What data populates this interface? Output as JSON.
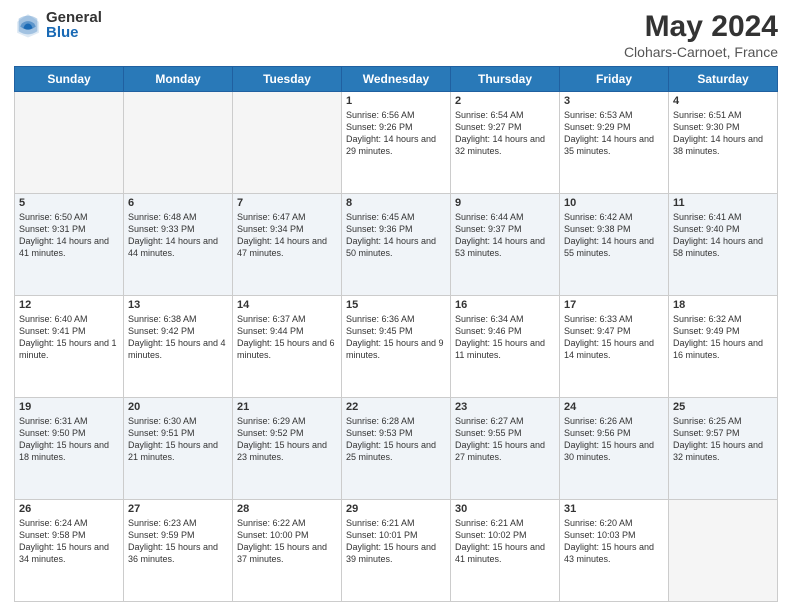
{
  "logo": {
    "general": "General",
    "blue": "Blue"
  },
  "header": {
    "title": "May 2024",
    "location": "Clohars-Carnoet, France"
  },
  "weekdays": [
    "Sunday",
    "Monday",
    "Tuesday",
    "Wednesday",
    "Thursday",
    "Friday",
    "Saturday"
  ],
  "weeks": [
    [
      {
        "day": "",
        "sunrise": "",
        "sunset": "",
        "daylight": ""
      },
      {
        "day": "",
        "sunrise": "",
        "sunset": "",
        "daylight": ""
      },
      {
        "day": "",
        "sunrise": "",
        "sunset": "",
        "daylight": ""
      },
      {
        "day": "1",
        "sunrise": "Sunrise: 6:56 AM",
        "sunset": "Sunset: 9:26 PM",
        "daylight": "Daylight: 14 hours and 29 minutes."
      },
      {
        "day": "2",
        "sunrise": "Sunrise: 6:54 AM",
        "sunset": "Sunset: 9:27 PM",
        "daylight": "Daylight: 14 hours and 32 minutes."
      },
      {
        "day": "3",
        "sunrise": "Sunrise: 6:53 AM",
        "sunset": "Sunset: 9:29 PM",
        "daylight": "Daylight: 14 hours and 35 minutes."
      },
      {
        "day": "4",
        "sunrise": "Sunrise: 6:51 AM",
        "sunset": "Sunset: 9:30 PM",
        "daylight": "Daylight: 14 hours and 38 minutes."
      }
    ],
    [
      {
        "day": "5",
        "sunrise": "Sunrise: 6:50 AM",
        "sunset": "Sunset: 9:31 PM",
        "daylight": "Daylight: 14 hours and 41 minutes."
      },
      {
        "day": "6",
        "sunrise": "Sunrise: 6:48 AM",
        "sunset": "Sunset: 9:33 PM",
        "daylight": "Daylight: 14 hours and 44 minutes."
      },
      {
        "day": "7",
        "sunrise": "Sunrise: 6:47 AM",
        "sunset": "Sunset: 9:34 PM",
        "daylight": "Daylight: 14 hours and 47 minutes."
      },
      {
        "day": "8",
        "sunrise": "Sunrise: 6:45 AM",
        "sunset": "Sunset: 9:36 PM",
        "daylight": "Daylight: 14 hours and 50 minutes."
      },
      {
        "day": "9",
        "sunrise": "Sunrise: 6:44 AM",
        "sunset": "Sunset: 9:37 PM",
        "daylight": "Daylight: 14 hours and 53 minutes."
      },
      {
        "day": "10",
        "sunrise": "Sunrise: 6:42 AM",
        "sunset": "Sunset: 9:38 PM",
        "daylight": "Daylight: 14 hours and 55 minutes."
      },
      {
        "day": "11",
        "sunrise": "Sunrise: 6:41 AM",
        "sunset": "Sunset: 9:40 PM",
        "daylight": "Daylight: 14 hours and 58 minutes."
      }
    ],
    [
      {
        "day": "12",
        "sunrise": "Sunrise: 6:40 AM",
        "sunset": "Sunset: 9:41 PM",
        "daylight": "Daylight: 15 hours and 1 minute."
      },
      {
        "day": "13",
        "sunrise": "Sunrise: 6:38 AM",
        "sunset": "Sunset: 9:42 PM",
        "daylight": "Daylight: 15 hours and 4 minutes."
      },
      {
        "day": "14",
        "sunrise": "Sunrise: 6:37 AM",
        "sunset": "Sunset: 9:44 PM",
        "daylight": "Daylight: 15 hours and 6 minutes."
      },
      {
        "day": "15",
        "sunrise": "Sunrise: 6:36 AM",
        "sunset": "Sunset: 9:45 PM",
        "daylight": "Daylight: 15 hours and 9 minutes."
      },
      {
        "day": "16",
        "sunrise": "Sunrise: 6:34 AM",
        "sunset": "Sunset: 9:46 PM",
        "daylight": "Daylight: 15 hours and 11 minutes."
      },
      {
        "day": "17",
        "sunrise": "Sunrise: 6:33 AM",
        "sunset": "Sunset: 9:47 PM",
        "daylight": "Daylight: 15 hours and 14 minutes."
      },
      {
        "day": "18",
        "sunrise": "Sunrise: 6:32 AM",
        "sunset": "Sunset: 9:49 PM",
        "daylight": "Daylight: 15 hours and 16 minutes."
      }
    ],
    [
      {
        "day": "19",
        "sunrise": "Sunrise: 6:31 AM",
        "sunset": "Sunset: 9:50 PM",
        "daylight": "Daylight: 15 hours and 18 minutes."
      },
      {
        "day": "20",
        "sunrise": "Sunrise: 6:30 AM",
        "sunset": "Sunset: 9:51 PM",
        "daylight": "Daylight: 15 hours and 21 minutes."
      },
      {
        "day": "21",
        "sunrise": "Sunrise: 6:29 AM",
        "sunset": "Sunset: 9:52 PM",
        "daylight": "Daylight: 15 hours and 23 minutes."
      },
      {
        "day": "22",
        "sunrise": "Sunrise: 6:28 AM",
        "sunset": "Sunset: 9:53 PM",
        "daylight": "Daylight: 15 hours and 25 minutes."
      },
      {
        "day": "23",
        "sunrise": "Sunrise: 6:27 AM",
        "sunset": "Sunset: 9:55 PM",
        "daylight": "Daylight: 15 hours and 27 minutes."
      },
      {
        "day": "24",
        "sunrise": "Sunrise: 6:26 AM",
        "sunset": "Sunset: 9:56 PM",
        "daylight": "Daylight: 15 hours and 30 minutes."
      },
      {
        "day": "25",
        "sunrise": "Sunrise: 6:25 AM",
        "sunset": "Sunset: 9:57 PM",
        "daylight": "Daylight: 15 hours and 32 minutes."
      }
    ],
    [
      {
        "day": "26",
        "sunrise": "Sunrise: 6:24 AM",
        "sunset": "Sunset: 9:58 PM",
        "daylight": "Daylight: 15 hours and 34 minutes."
      },
      {
        "day": "27",
        "sunrise": "Sunrise: 6:23 AM",
        "sunset": "Sunset: 9:59 PM",
        "daylight": "Daylight: 15 hours and 36 minutes."
      },
      {
        "day": "28",
        "sunrise": "Sunrise: 6:22 AM",
        "sunset": "Sunset: 10:00 PM",
        "daylight": "Daylight: 15 hours and 37 minutes."
      },
      {
        "day": "29",
        "sunrise": "Sunrise: 6:21 AM",
        "sunset": "Sunset: 10:01 PM",
        "daylight": "Daylight: 15 hours and 39 minutes."
      },
      {
        "day": "30",
        "sunrise": "Sunrise: 6:21 AM",
        "sunset": "Sunset: 10:02 PM",
        "daylight": "Daylight: 15 hours and 41 minutes."
      },
      {
        "day": "31",
        "sunrise": "Sunrise: 6:20 AM",
        "sunset": "Sunset: 10:03 PM",
        "daylight": "Daylight: 15 hours and 43 minutes."
      },
      {
        "day": "",
        "sunrise": "",
        "sunset": "",
        "daylight": ""
      }
    ]
  ]
}
